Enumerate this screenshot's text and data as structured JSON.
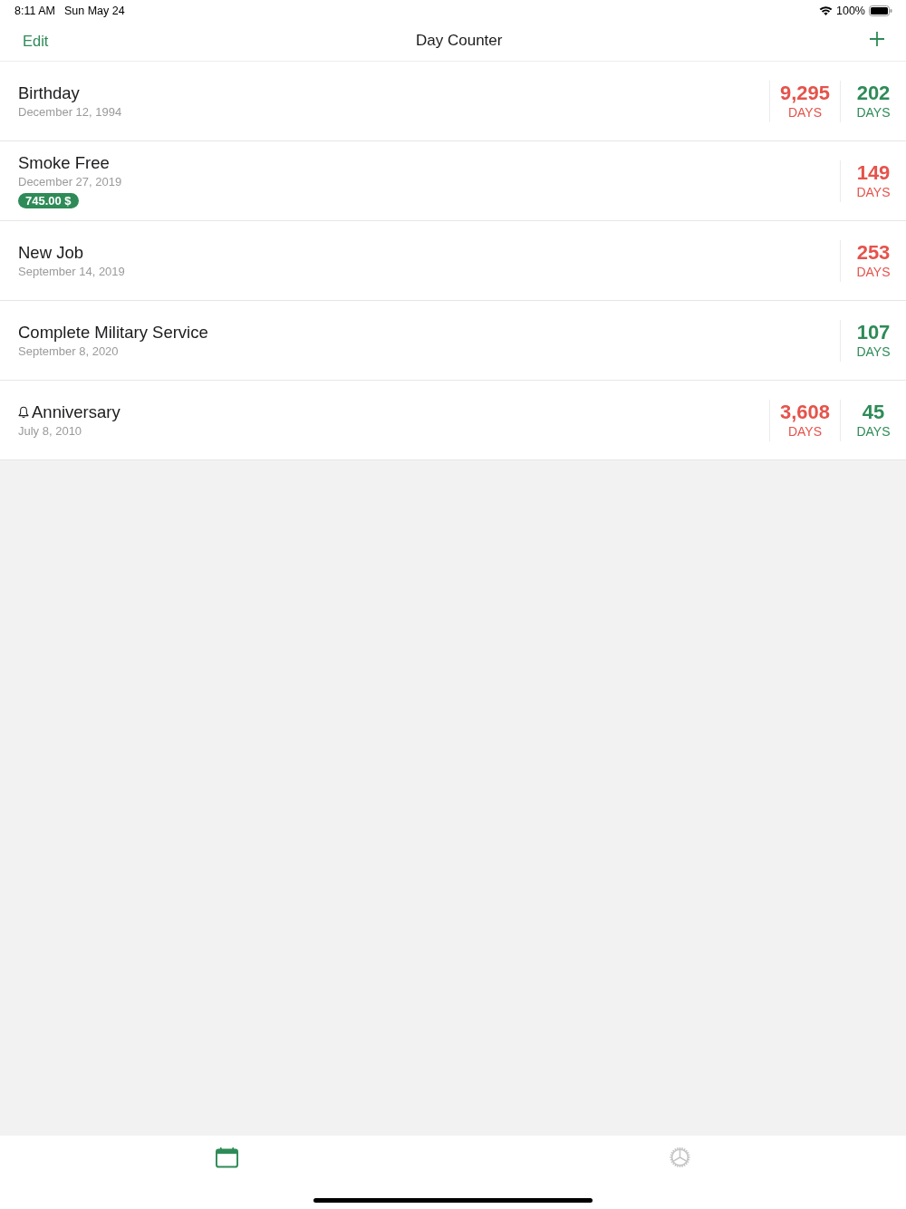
{
  "status_bar": {
    "time": "8:11 AM",
    "date": "Sun May 24",
    "battery": "100%"
  },
  "nav_bar": {
    "left_button": "Edit",
    "title": "Day Counter"
  },
  "events": [
    {
      "title": "Birthday",
      "date": "December 12, 1994",
      "alert": false,
      "counters": [
        {
          "value": "9,295",
          "unit": "DAYS",
          "color": "#e5534b"
        },
        {
          "value": "202",
          "unit": "DAYS",
          "color": "#2e8b57"
        }
      ]
    },
    {
      "title": "Smoke Free",
      "date": "December 27, 2019",
      "alert": false,
      "badge": "745.00 $",
      "counters": [
        {
          "value": "149",
          "unit": "DAYS",
          "color": "#e5534b"
        }
      ]
    },
    {
      "title": "New Job",
      "date": "September 14, 2019",
      "alert": false,
      "counters": [
        {
          "value": "253",
          "unit": "DAYS",
          "color": "#e5534b"
        }
      ]
    },
    {
      "title": "Complete Military Service",
      "date": "September 8, 2020",
      "alert": false,
      "counters": [
        {
          "value": "107",
          "unit": "DAYS",
          "color": "#2e8b57"
        }
      ]
    },
    {
      "title": "Anniversary",
      "date": "July 8, 2010",
      "alert": true,
      "counters": [
        {
          "value": "3,608",
          "unit": "DAYS",
          "color": "#e5534b"
        },
        {
          "value": "45",
          "unit": "DAYS",
          "color": "#2e8b57"
        }
      ]
    }
  ],
  "tab_bar": [
    {
      "kind": "calendar",
      "selected": true
    },
    {
      "kind": "settings",
      "selected": false
    }
  ]
}
